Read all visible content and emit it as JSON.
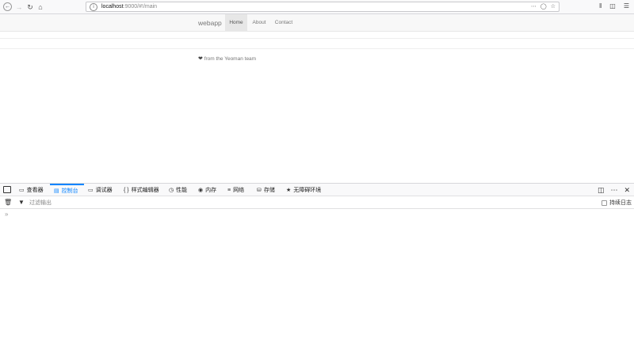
{
  "browser": {
    "url_host": "localhost",
    "url_path": ":9000/#!/main"
  },
  "page": {
    "brand": "webapp",
    "nav": [
      "Home",
      "About",
      "Contact"
    ],
    "footer": "from the Yeoman team"
  },
  "devtools": {
    "tabs": [
      "查看器",
      "控制台",
      "调试器",
      "样式编辑器",
      "性能",
      "内存",
      "网络",
      "存储",
      "无障碍环境"
    ],
    "filter_placeholder": "过滤输出",
    "persist_logs": "持续日志"
  }
}
